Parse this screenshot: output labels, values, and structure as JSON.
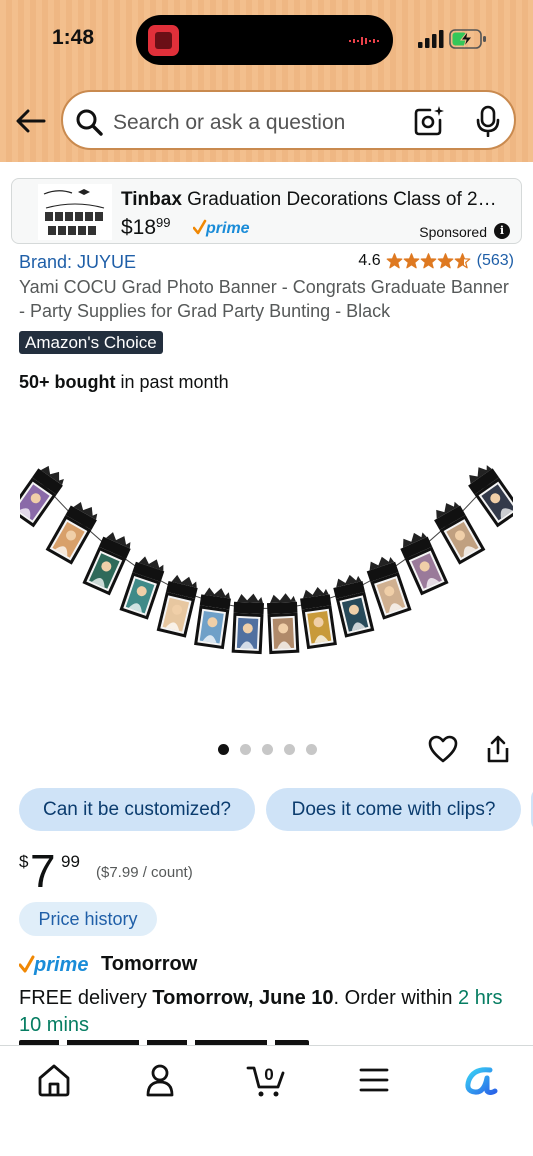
{
  "status_bar": {
    "time": "1:48"
  },
  "search": {
    "placeholder": "Search or ask a question"
  },
  "sponsored": {
    "brand": "Tinbax",
    "title_rest": " Graduation Decorations Class of 2…",
    "price_whole": "$18",
    "price_fraction": "99",
    "prime_label": "prime",
    "sponsored_label": "Sponsored",
    "info_glyph": "i"
  },
  "product": {
    "brand": "Brand: JUYUE",
    "rating_value": "4.6",
    "rating_stars": 4.6,
    "rating_count": "(563)",
    "title": "Yami COCU Grad Photo Banner - Congrats Graduate Banner - Party Supplies for Grad Party Bunting - Black",
    "badge": "Amazon's Choice",
    "bought_bold": "50+ bought",
    "bought_rest": " in past month"
  },
  "gallery": {
    "image_count": 5,
    "active_index": 0
  },
  "chips": [
    "Can it be customized?",
    "Does it come with clips?"
  ],
  "price": {
    "symbol": "$",
    "whole": "7",
    "fraction": "99",
    "unit_price": "($7.99 / count)",
    "history_label": "Price history"
  },
  "delivery": {
    "prime_label": "prime",
    "prime_tomorrow": "Tomorrow",
    "free_prefix": "FREE delivery ",
    "date_bold": "Tomorrow, June 10",
    "order_within": ". Order within ",
    "countdown": "2 hrs 10 mins"
  },
  "cart": {
    "count": "0"
  },
  "colors": {
    "header_bg": "#f3bf8d",
    "link_blue": "#1f5fa8",
    "prime_blue": "#1a8cd8",
    "prime_check": "#f08804",
    "star_orange": "#de7921",
    "chip_bg": "#cfe3f7",
    "badge_bg": "#232f3e",
    "countdown_green": "#067d62"
  },
  "icons": [
    "back-arrow-icon",
    "search-icon",
    "camera-search-icon",
    "microphone-icon",
    "heart-icon",
    "share-icon",
    "home-icon",
    "account-icon",
    "cart-icon",
    "menu-icon",
    "rufus-icon"
  ]
}
